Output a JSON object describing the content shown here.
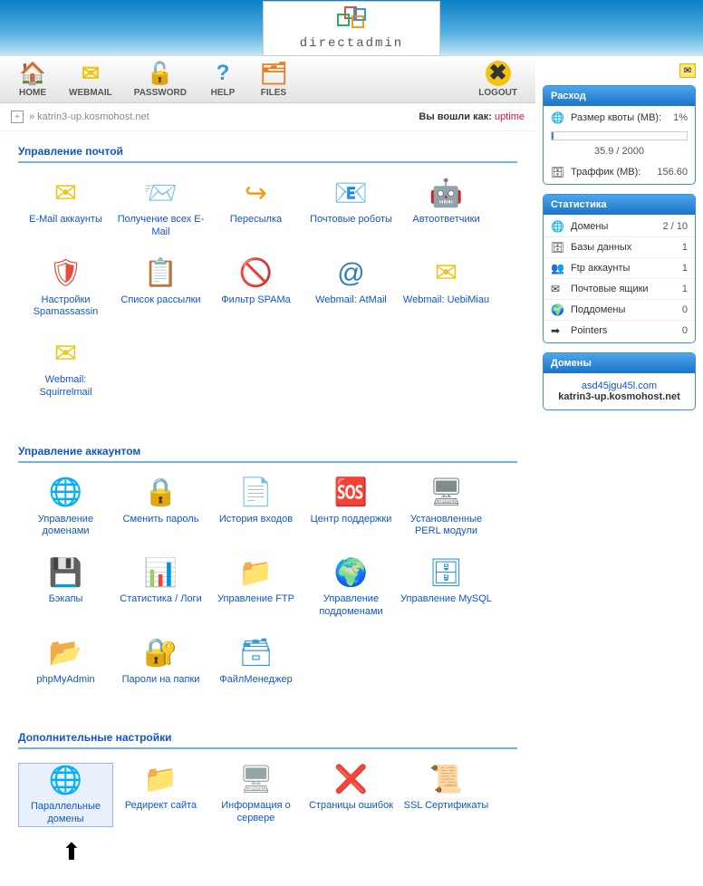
{
  "brand": "directadmin",
  "toolbar": [
    {
      "key": "home",
      "label": "HOME",
      "icon": "🏠",
      "color": "#e67e22"
    },
    {
      "key": "webmail",
      "label": "WEBMAIL",
      "icon": "✉",
      "color": "#f1c40f"
    },
    {
      "key": "password",
      "label": "PASSWORD",
      "icon": "🔓",
      "color": "#f39c12"
    },
    {
      "key": "help",
      "label": "HELP",
      "icon": "?",
      "color": "#3498db"
    },
    {
      "key": "files",
      "label": "FILES",
      "icon": "🗂",
      "color": "#e67e22"
    }
  ],
  "logout": {
    "label": "LOGOUT",
    "icon": "✖",
    "color": "#f1c40f"
  },
  "breadcrumb": {
    "text": "» katrin3-up.kosmohost.net"
  },
  "logged_as": {
    "label": "Вы вошли как:",
    "user": "uptime"
  },
  "sections": [
    {
      "title": "Управление почтой",
      "items": [
        {
          "label": "E-Mail аккаунты",
          "icon": "✉",
          "c": "#f1c40f"
        },
        {
          "label": "Получение всех E-Mail",
          "icon": "📨",
          "c": "#f1c40f"
        },
        {
          "label": "Пересылка",
          "icon": "↪",
          "c": "#f39c12"
        },
        {
          "label": "Почтовые роботы",
          "icon": "📧",
          "c": "#f1c40f"
        },
        {
          "label": "Автоответчики",
          "icon": "🤖",
          "c": "#e67e22"
        },
        {
          "label": "Настройки Spamassassin",
          "icon": "🛡",
          "c": "#e74c3c"
        },
        {
          "label": "Список рассылки",
          "icon": "📋",
          "c": "#f1c40f"
        },
        {
          "label": "Фильтр SPAMa",
          "icon": "🚫",
          "c": "#e74c3c"
        },
        {
          "label": "Webmail: AtMail",
          "icon": "@",
          "c": "#2980b9"
        },
        {
          "label": "Webmail: UebiMiau",
          "icon": "✉",
          "c": "#f1c40f"
        },
        {
          "label": "Webmail: Squirrelmail",
          "icon": "✉",
          "c": "#f1c40f"
        }
      ]
    },
    {
      "title": "Управление аккаунтом",
      "items": [
        {
          "label": "Управление доменами",
          "icon": "🌐",
          "c": "#2980b9"
        },
        {
          "label": "Сменить пароль",
          "icon": "🔒",
          "c": "#f39c12"
        },
        {
          "label": "История входов",
          "icon": "📄",
          "c": "#95a5a6"
        },
        {
          "label": "Центр поддержки",
          "icon": "🆘",
          "c": "#e74c3c"
        },
        {
          "label": "Установленные PERL модули",
          "icon": "🖥",
          "c": "#7f8c8d"
        },
        {
          "label": "Бэкапы",
          "icon": "💾",
          "c": "#f39c12"
        },
        {
          "label": "Статистика / Логи",
          "icon": "📊",
          "c": "#e67e22"
        },
        {
          "label": "Управление FTP",
          "icon": "📁",
          "c": "#f39c12"
        },
        {
          "label": "Управление поддоменами",
          "icon": "🌍",
          "c": "#2980b9"
        },
        {
          "label": "Управление MySQL",
          "icon": "🗄",
          "c": "#3498db"
        },
        {
          "label": "phpMyAdmin",
          "icon": "📂",
          "c": "#f39c12"
        },
        {
          "label": "Пароли на папки",
          "icon": "🔐",
          "c": "#f39c12"
        },
        {
          "label": "ФайлМенеджер",
          "icon": "🗃",
          "c": "#3498db"
        }
      ]
    },
    {
      "title": "Дополнительные настройки",
      "items": [
        {
          "label": "Параллельные домены",
          "icon": "🌐",
          "c": "#27ae60",
          "selected": true
        },
        {
          "label": "Редирект сайта",
          "icon": "📁",
          "c": "#f39c12"
        },
        {
          "label": "Информация о сервере",
          "icon": "🖥",
          "c": "#95a5a6"
        },
        {
          "label": "Страницы ошибок",
          "icon": "❌",
          "c": "#e74c3c"
        },
        {
          "label": "SSL Сертификаты",
          "icon": "📜",
          "c": "#3498db"
        }
      ]
    }
  ],
  "side_usage": {
    "title": "Расход",
    "quota": {
      "label": "Размер квоты (MB):",
      "pct": "1%",
      "text": "35.9 / 2000"
    },
    "traffic": {
      "label": "Траффик (MB):",
      "val": "156.60"
    }
  },
  "side_stats": {
    "title": "Статистика",
    "rows": [
      {
        "icon": "🌐",
        "label": "Домены",
        "val": "2 / 10"
      },
      {
        "icon": "🗄",
        "label": "Базы данных",
        "val": "1"
      },
      {
        "icon": "👥",
        "label": "Ftp аккаунты",
        "val": "1"
      },
      {
        "icon": "✉",
        "label": "Почтовые ящики",
        "val": "1"
      },
      {
        "icon": "🌍",
        "label": "Поддомены",
        "val": "0"
      },
      {
        "icon": "➡",
        "label": "Pointers",
        "val": "0"
      }
    ]
  },
  "side_domains": {
    "title": "Домены",
    "list": [
      {
        "name": "asd45jgu45l.com",
        "active": false
      },
      {
        "name": "katrin3-up.kosmohost.net",
        "active": true
      }
    ]
  }
}
